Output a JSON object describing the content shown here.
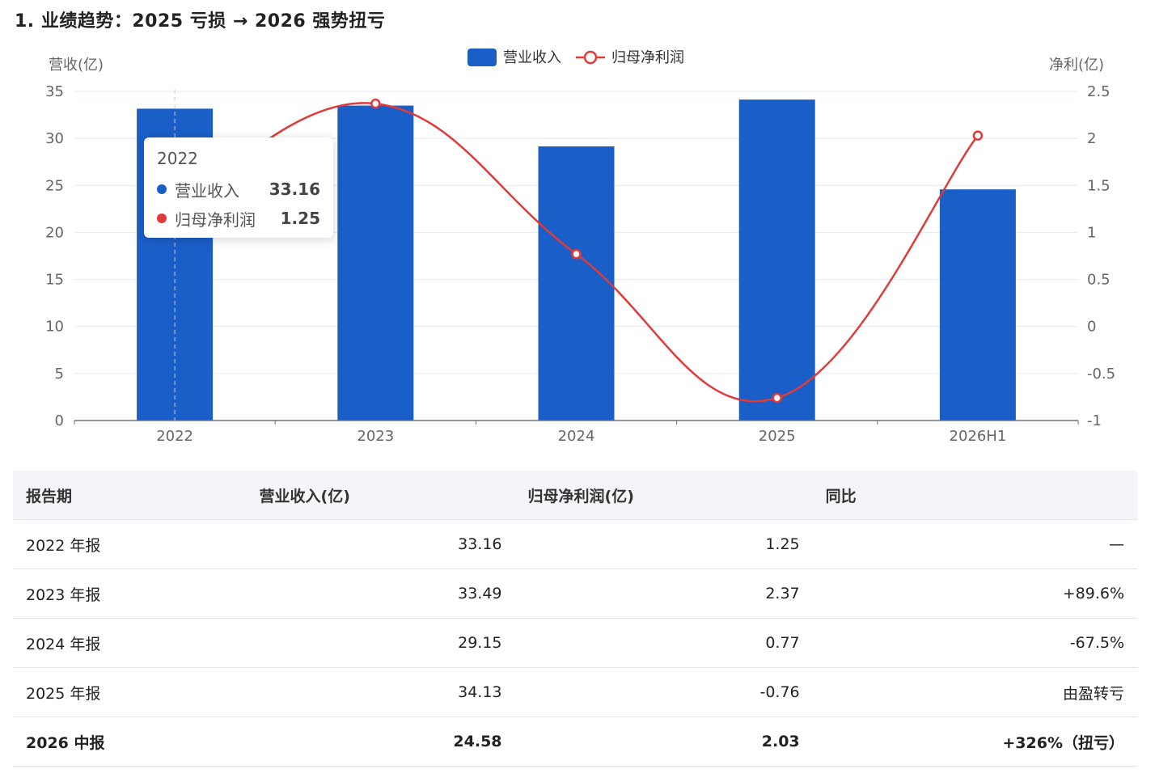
{
  "title": "1. 业绩趋势：2025 亏损 → 2026 强势扭亏",
  "chart_data": {
    "type": "bar",
    "categories": [
      "2022",
      "2023",
      "2024",
      "2025",
      "2026H1"
    ],
    "series": [
      {
        "name": "营业收入",
        "type": "bar",
        "axis": "left",
        "color": "#1a5fc8",
        "values": [
          33.16,
          33.49,
          29.15,
          34.13,
          24.58
        ]
      },
      {
        "name": "归母净利润",
        "type": "line",
        "axis": "right",
        "color": "#e03a3a",
        "values": [
          1.25,
          2.37,
          0.77,
          -0.76,
          2.03
        ]
      }
    ],
    "y_left": {
      "label": "营收(亿)",
      "ylim": [
        0,
        35
      ],
      "ticks": [
        "0",
        "5",
        "10",
        "15",
        "20",
        "25",
        "30",
        "35"
      ]
    },
    "y_right": {
      "label": "净利(亿)",
      "ylim": [
        -1,
        2.5
      ],
      "ticks": [
        "-1",
        "-0.5",
        "0",
        "0.5",
        "1",
        "1.5",
        "2",
        "2.5"
      ]
    },
    "legend": "top-center",
    "grid": true
  },
  "tooltip": {
    "title": "2022",
    "rows": [
      {
        "name": "营业收入",
        "value": "33.16",
        "color": "#1a5fc8"
      },
      {
        "name": "归母净利润",
        "value": "1.25",
        "color": "#e03a3a"
      }
    ]
  },
  "table": {
    "headers": [
      "报告期",
      "营业收入(亿)",
      "归母净利润(亿)",
      "同比"
    ],
    "rows": [
      {
        "period": "2022 年报",
        "revenue": "33.16",
        "profit": "1.25",
        "yoy": "—",
        "yoy_class": "black",
        "profit_class": "black"
      },
      {
        "period": "2023 年报",
        "revenue": "33.49",
        "profit": "2.37",
        "yoy": "+89.6%",
        "yoy_class": "pos",
        "profit_class": "black"
      },
      {
        "period": "2024 年报",
        "revenue": "29.15",
        "profit": "0.77",
        "yoy": "-67.5%",
        "yoy_class": "neg",
        "profit_class": "black"
      },
      {
        "period": "2025 年报",
        "revenue": "34.13",
        "profit": "-0.76",
        "yoy": "由盈转亏",
        "yoy_class": "neg",
        "profit_class": "neg"
      },
      {
        "period": "2026 中报",
        "revenue": "24.58",
        "profit": "2.03",
        "yoy": "+326%（扭亏）",
        "yoy_class": "pos",
        "profit_class": "pos"
      }
    ]
  }
}
